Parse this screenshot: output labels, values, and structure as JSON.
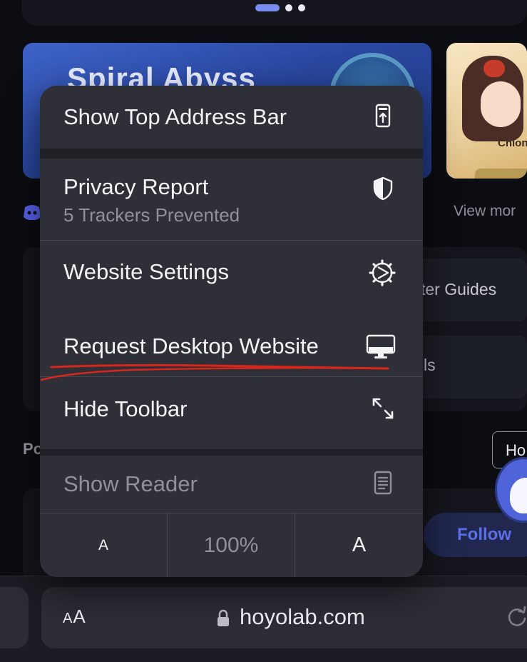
{
  "background": {
    "banner_title": "Spiral Abyss",
    "character_name": "Chion",
    "character_stars": "★★★★",
    "view_more": "View mor",
    "guides_label": "ter Guides",
    "tools_label": "ls",
    "section_title": "Po",
    "hoyo_button": "Ho",
    "follow_label": "Follow"
  },
  "menu": {
    "show_top_address_bar": "Show Top Address Bar",
    "privacy_report": "Privacy Report",
    "privacy_subtitle": "5 Trackers Prevented",
    "website_settings": "Website Settings",
    "request_desktop_website": "Request Desktop Website",
    "hide_toolbar": "Hide Toolbar",
    "show_reader": "Show Reader",
    "zoom_smaller": "A",
    "zoom_level": "100%",
    "zoom_larger": "A"
  },
  "address_bar": {
    "aa_small": "A",
    "aa_large": "A",
    "url": "hoyolab.com"
  },
  "colors": {
    "menu_background": "#2f3037",
    "annotation_red": "#d7261b",
    "follow_accent": "#5b6fe6"
  },
  "icons": {
    "show_top_address_bar": "phone-top-bar-icon",
    "privacy_report": "shield-icon",
    "website_settings": "gear-icon",
    "request_desktop_website": "desktop-monitor-icon",
    "hide_toolbar": "expand-arrows-icon",
    "show_reader": "reader-document-icon"
  }
}
